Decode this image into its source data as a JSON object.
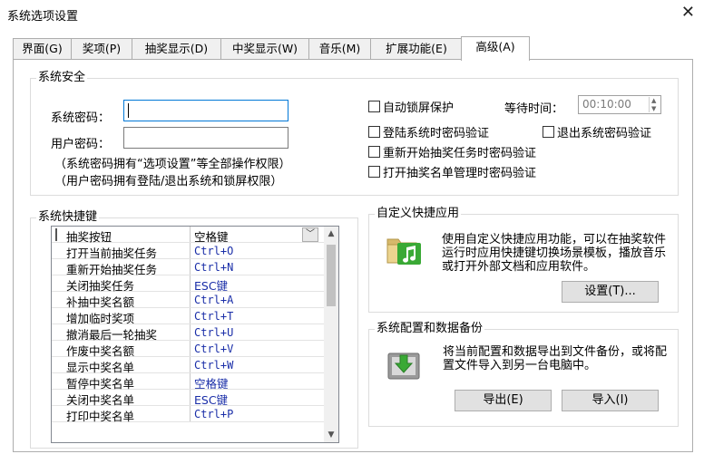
{
  "window": {
    "title": "系统选项设置",
    "close_glyph": "✕"
  },
  "tabs": [
    {
      "label": "界面(G)"
    },
    {
      "label": "奖项(P)"
    },
    {
      "label": "抽奖显示(D)"
    },
    {
      "label": "中奖显示(W)"
    },
    {
      "label": "音乐(M)"
    },
    {
      "label": "扩展功能(E)"
    },
    {
      "label": "高级(A)",
      "active": true
    }
  ],
  "security": {
    "title": "系统安全",
    "system_password_label": "系统密码：",
    "user_password_label": "用户密码：",
    "note1": "（系统密码拥有“选项设置”等全部操作权限）",
    "note2": "（用户密码拥有登陆/退出系统和锁屏权限）",
    "auto_lock_label": "自动锁屏保护",
    "wait_time_label": "等待时间：",
    "wait_time_value": "00:10:00",
    "login_verify_label": "登陆系统时密码验证",
    "logout_verify_label": "退出系统密码验证",
    "restart_verify_label": "重新开始抽奖任务时密码验证",
    "open_list_verify_label": "打开抽奖名单管理时密码验证"
  },
  "hotkeys": {
    "title": "系统快捷键",
    "header": {
      "action": "抽奖按钮",
      "key": "空格键"
    },
    "rows": [
      {
        "action": "打开当前抽奖任务",
        "key": "Ctrl+O"
      },
      {
        "action": "重新开始抽奖任务",
        "key": "Ctrl+N"
      },
      {
        "action": "关闭抽奖任务",
        "key": "ESC键"
      },
      {
        "action": "补抽中奖名额",
        "key": "Ctrl+A"
      },
      {
        "action": "增加临时奖项",
        "key": "Ctrl+T"
      },
      {
        "action": "撤消最后一轮抽奖",
        "key": "Ctrl+U"
      },
      {
        "action": "作废中奖名额",
        "key": "Ctrl+V"
      },
      {
        "action": "显示中奖名单",
        "key": "Ctrl+W"
      },
      {
        "action": "暂停中奖名单",
        "key": "空格键"
      },
      {
        "action": "关闭中奖名单",
        "key": "ESC键"
      },
      {
        "action": "打印中奖名单",
        "key": "Ctrl+P"
      }
    ]
  },
  "quick_app": {
    "title": "自定义快捷应用",
    "desc": "使用自定义快捷应用功能，可以在抽奖软件运行时应用快捷键切换场景模板，播放音乐或打开外部文档和应用软件。",
    "settings_button": "设置(T)..."
  },
  "backup": {
    "title": "系统配置和数据备份",
    "desc": "将当前配置和数据导出到文件备份，或将配置文件导入到另一台电脑中。",
    "export_button": "导出(E)",
    "import_button": "导入(I)"
  },
  "colors": {
    "accent": "#0078d7",
    "hotkey_text": "#1a2ea8",
    "folder": "#d7b96b",
    "music_green": "#3aa935"
  },
  "icons": {
    "close": "close-icon",
    "dropdown": "chevron-down-icon",
    "scroll_up": "scroll-up-icon",
    "scroll_down": "scroll-down-icon",
    "folder_music": "folder-music-icon",
    "import_export": "import-export-icon"
  }
}
